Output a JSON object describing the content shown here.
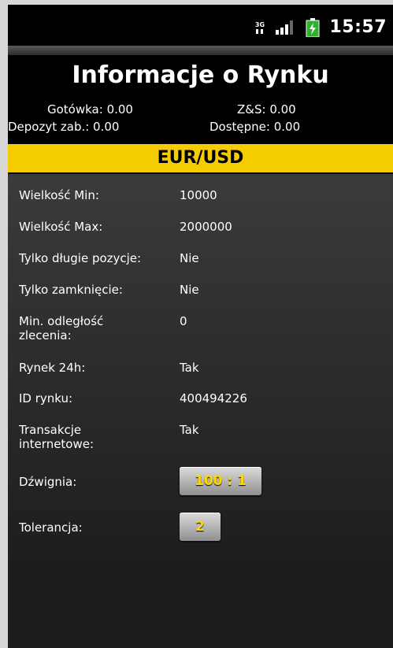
{
  "status_bar": {
    "time": "15:57",
    "icons": [
      "data-3g-icon",
      "signal-icon",
      "battery-icon"
    ],
    "data_label": "3G"
  },
  "header": {
    "title": "Informacje o Rynku"
  },
  "summary": {
    "cash_label": "Gotówka: 0.00",
    "pnl_label": "Z&S: 0.00",
    "margin_label": "Depozyt zab.: 0.00",
    "available_label": "Dostępne: 0.00"
  },
  "market": {
    "instrument": "EUR/USD"
  },
  "details": [
    {
      "label": "Wielkość Min:",
      "value": "10000"
    },
    {
      "label": "Wielkość Max:",
      "value": "2000000"
    },
    {
      "label": "Tylko długie pozycje:",
      "value": "Nie"
    },
    {
      "label": "Tylko zamknięcie:",
      "value": "Nie"
    },
    {
      "label": "Min. odległość zlecenia:",
      "value": "0"
    },
    {
      "label": "Rynek 24h:",
      "value": "Tak"
    },
    {
      "label": "ID rynku:",
      "value": "400494226"
    },
    {
      "label": "Transakcje internetowe:",
      "value": "Tak"
    }
  ],
  "controls": {
    "leverage_label": "Dźwignia:",
    "leverage_value": "100 : 1",
    "tolerance_label": "Tolerancja:",
    "tolerance_value": "2"
  },
  "colors": {
    "accent": "#f4cc00",
    "button_text": "#ffd800",
    "background": "#000000"
  }
}
